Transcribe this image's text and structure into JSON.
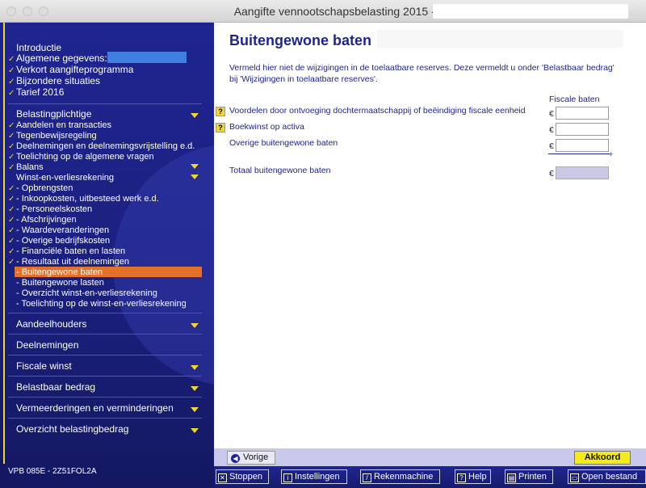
{
  "window": {
    "title": "Aangifte vennootschapsbelasting 2015 - Buitengewone baten"
  },
  "sidebar": {
    "top_items": [
      {
        "label": "Introductie",
        "checked": false
      },
      {
        "label": "Algemene gegevens:",
        "checked": true
      },
      {
        "label": "Verkort aangifteprogramma",
        "checked": true
      },
      {
        "label": "Bijzondere situaties",
        "checked": true
      },
      {
        "label": "Tarief 2016",
        "checked": true
      }
    ],
    "section_belasting": "Belastingplichtige",
    "items": [
      {
        "label": "Aandelen en transacties",
        "checked": true
      },
      {
        "label": "Tegenbewijsregeling",
        "checked": true
      },
      {
        "label": "Deelnemingen en deelnemingsvrijstelling e.d.",
        "checked": true
      },
      {
        "label": "Toelichting op de algemene vragen",
        "checked": true
      },
      {
        "label": "Balans",
        "checked": true
      },
      {
        "label": "Winst-en-verliesrekening",
        "checked": false
      },
      {
        "label": "- Opbrengsten",
        "checked": true
      },
      {
        "label": "- Inkoopkosten, uitbesteed werk e.d.",
        "checked": true
      },
      {
        "label": "- Personeelskosten",
        "checked": true
      },
      {
        "label": "- Afschrijvingen",
        "checked": true
      },
      {
        "label": "- Waardeveranderingen",
        "checked": true
      },
      {
        "label": "- Overige bedrijfskosten",
        "checked": true
      },
      {
        "label": "- Financiële baten en lasten",
        "checked": true
      },
      {
        "label": "- Resultaat uit deelnemingen",
        "checked": true
      },
      {
        "label": "- Buitengewone baten",
        "checked": false
      },
      {
        "label": "- Buitengewone lasten",
        "checked": false
      },
      {
        "label": "- Overzicht winst-en-verliesrekening",
        "checked": false
      },
      {
        "label": "- Toelichting op de winst-en-verliesrekening",
        "checked": false
      }
    ],
    "sections": [
      "Aandeelhouders",
      "Deelnemingen",
      "Fiscale winst",
      "Belastbaar bedrag",
      "Vermeerderingen en verminderingen",
      "Overzicht belastingbedrag"
    ],
    "version": "VPB 085E - 2Z51FOL2A"
  },
  "main": {
    "title": "Buitengewone baten",
    "intro": "Vermeld hier niet de wijzigingen in de toelaatbare reserves. Deze vermeldt u onder 'Belastbaar bedrag' bij 'Wijzigingen in toelaatbare reserves'.",
    "column_header": "Fiscale baten",
    "currency": "€",
    "rows": [
      {
        "label": "Voordelen door ontvoeging dochtermaatschappij of beëindiging fiscale eenheid",
        "value": ""
      },
      {
        "label": "Boekwinst op activa",
        "value": ""
      },
      {
        "label": "Overige buitengewone baten",
        "value": ""
      }
    ],
    "total_label": "Totaal buitengewone baten",
    "total_value": "",
    "help_glyph": "?",
    "plus_glyph": "+"
  },
  "footer": {
    "prev_label": "Vorige",
    "ok_label": "Akkoord"
  },
  "toolbar": {
    "stop": "Stoppen",
    "settings": "Instellingen",
    "calc": "Rekenmachine",
    "help": "Help",
    "print": "Printen",
    "open": "Open bestand"
  },
  "colors": {
    "navy": "#1f2590",
    "accent_yellow": "#f2d630",
    "active_orange": "#e4712a"
  }
}
